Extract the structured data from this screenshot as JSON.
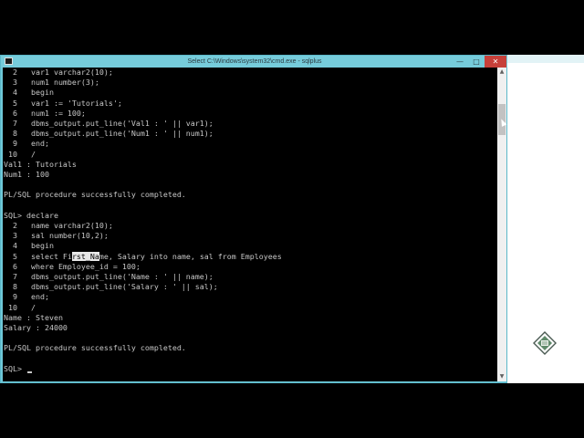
{
  "window": {
    "title": "Select C:\\Windows\\system32\\cmd.exe - sqlplus",
    "buttons": {
      "minimize": "—",
      "maximize": "□",
      "close": "✕"
    },
    "icon": "console-icon"
  },
  "console": {
    "lines": [
      "  2   var1 varchar2(10);",
      "  3   num1 number(3);",
      "  4   begin",
      "  5   var1 := 'Tutorials';",
      "  6   num1 := 100;",
      "  7   dbms_output.put_line('Val1 : ' || var1);",
      "  8   dbms_output.put_line('Num1 : ' || num1);",
      "  9   end;",
      " 10   /",
      "Val1 : Tutorials",
      "Num1 : 100",
      "",
      "PL/SQL procedure successfully completed.",
      "",
      "SQL> declare",
      "  2   name varchar2(10);",
      "  3   sal number(10,2);",
      "  4   begin",
      "  5   select First_Name, Salary into name, sal from Employees",
      "  6   where Employee_id = 100;",
      "  7   dbms_output.put_line('Name : ' || name);",
      "  8   dbms_output.put_line('Salary : ' || sal);",
      "  9   end;",
      " 10   /",
      "Name : Steven",
      "Salary : 24000",
      "",
      "PL/SQL procedure successfully completed.",
      "",
      "SQL> "
    ],
    "selection": {
      "line": 18,
      "before": "  5   select Fi",
      "text": "rst_Na",
      "after": "me, Salary into name, sal from Employees"
    }
  },
  "colors": {
    "titlebar": "#76ccdb",
    "console_bg": "#000000",
    "console_text": "#c8c8c8",
    "close_button": "#c7403a"
  },
  "icons": {
    "scroll_up": "▲",
    "scroll_down": "▼"
  }
}
